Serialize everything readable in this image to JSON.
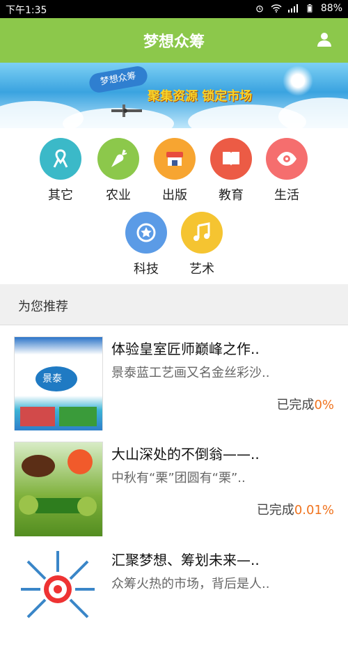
{
  "statusbar": {
    "time": "下午1:35",
    "battery": "88%"
  },
  "header": {
    "title": "梦想众筹"
  },
  "banner": {
    "brand": "梦想众筹",
    "slogan": "聚集资源 锁定市场"
  },
  "categories": [
    {
      "label": "其它",
      "color": "#3bb9c8",
      "icon": "ribbon-icon"
    },
    {
      "label": "农业",
      "color": "#8cc84b",
      "icon": "carrot-icon"
    },
    {
      "label": "出版",
      "color": "#f7a531",
      "icon": "shop-icon"
    },
    {
      "label": "教育",
      "color": "#ec5b45",
      "icon": "book-icon"
    },
    {
      "label": "生活",
      "color": "#f56e6e",
      "icon": "eye-icon"
    },
    {
      "label": "科技",
      "color": "#5b9be6",
      "icon": "star-badge-icon"
    },
    {
      "label": "艺术",
      "color": "#f5c431",
      "icon": "music-icon"
    }
  ],
  "recommend": {
    "header": "为您推荐",
    "items": [
      {
        "title": "体验皇室匠师巅峰之作..",
        "desc": "景泰蓝工艺画又名金丝彩沙..",
        "status_label": "已完成",
        "percent": "0%"
      },
      {
        "title": "大山深处的不倒翁——..",
        "desc": "中秋有“栗”团圆有“栗”..",
        "status_label": "已完成",
        "percent": "0.01%"
      },
      {
        "title": "汇聚梦想、筹划未来—..",
        "desc": "众筹火热的市场，背后是人..",
        "status_label": "",
        "percent": ""
      }
    ]
  }
}
